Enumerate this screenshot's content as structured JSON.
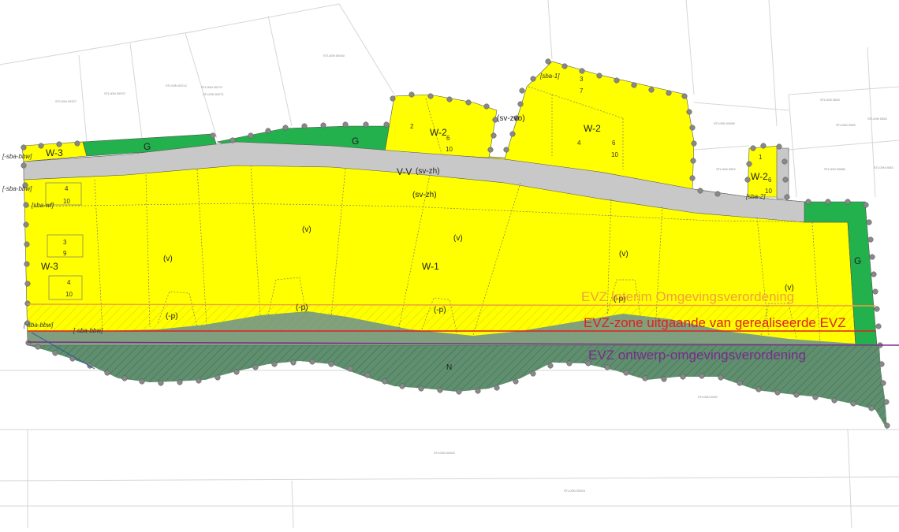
{
  "zones": {
    "w3_top": "W-3",
    "w3_left": "W-3",
    "w2_a": "W-2",
    "w2_b": "W-2",
    "w2_c": "W-2",
    "w1": "W-1",
    "g_left": "G",
    "g_mid": "G",
    "g_right": "G",
    "vv": "V-V",
    "n": "N"
  },
  "annotations": {
    "sv_zh_road": "(sv-zh)",
    "sv_zh_lower": "(sv-zh)",
    "sv_zvo": "(sv-zvo)",
    "v": "(v)",
    "p": "(-p)",
    "p_bracket": "(-p)",
    "sba_bbw_1": "[-sba-bbw]",
    "sba_bbw_2": "[-sba-bbw]",
    "sba_bbw_3": "[-sba-bbw]",
    "sba_bbw_4": "[-sba-bbw]",
    "sba_wf": "[sba-wf]",
    "sba_1": "[sba-1]",
    "sba_2": "[sba-2]"
  },
  "numbers": {
    "n4a": "4",
    "n10a": "10",
    "n3": "3",
    "n9": "9",
    "n4b": "4",
    "n10b": "10",
    "n2": "2",
    "n6a": "6",
    "n10c": "10",
    "n3b": "3",
    "n7": "7",
    "n4c": "4",
    "n6b": "6",
    "n10d": "10",
    "n1": "1",
    "n6c": "6",
    "n10e": "10"
  },
  "legend": {
    "interim": "EVZ Interim Omgevingsverordening",
    "gerealiseerd": "EVZ-zone uitgaande van gerealiseerde EVZ",
    "ontwerp": "EVZ ontwerp-omgevingsverordening"
  },
  "colors": {
    "residential": "#ffff00",
    "green": "#22b14c",
    "road": "#c8c8c8",
    "nature": "#5f8f6f",
    "interim_line": "#f0a040",
    "gerealiseerd_line": "#e02020",
    "ontwerp_line": "#7a2a8a"
  }
}
